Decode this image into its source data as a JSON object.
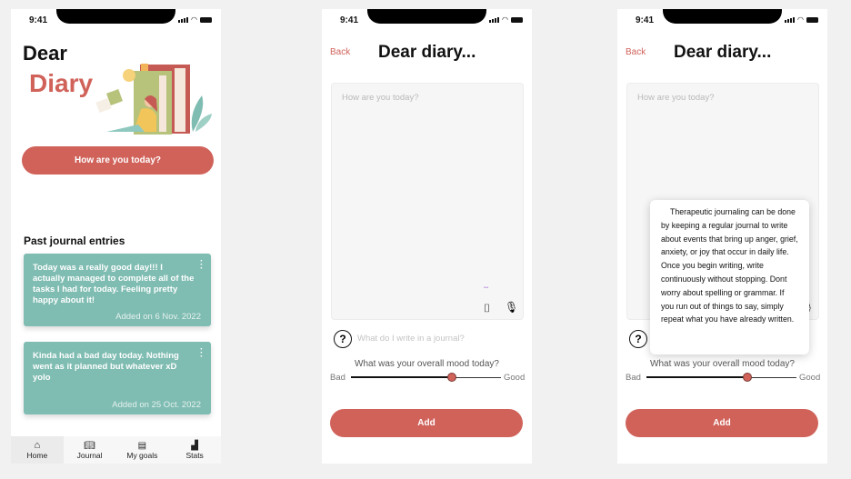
{
  "status": {
    "time": "9:41"
  },
  "home": {
    "title_line1": "Dear",
    "title_line2": "Diary",
    "cta": "How are you today?",
    "section_title": "Past journal entries",
    "entries": [
      {
        "text": "Today was a really good day!!! I actually managed to complete all of the tasks I had for today. Feeling pretty happy about it!",
        "date": "Added on 6 Nov. 2022"
      },
      {
        "text": "Kinda had a bad day today. Nothing went as it planned but whatever xD yolo",
        "date": "Added on 25 Oct. 2022"
      }
    ],
    "nav": [
      {
        "label": "Home",
        "icon": "home-icon"
      },
      {
        "label": "Journal",
        "icon": "book-icon"
      },
      {
        "label": "My goals",
        "icon": "goals-icon"
      },
      {
        "label": "Stats",
        "icon": "stats-icon"
      }
    ]
  },
  "entry": {
    "back": "Back",
    "title": "Dear diary...",
    "placeholder": "How are you today?",
    "dots": "•••",
    "help": "?",
    "help_text": "What do I write in a journal?",
    "mood_question": "What was your overall mood today?",
    "bad": "Bad",
    "good": "Good",
    "mood_value": 0.67,
    "add": "Add",
    "tip": "Therapeutic journaling can be done by keeping a regular journal to write about events that bring up anger, grief, anxiety, or joy that occur in daily life. Once you begin writing, write continuously without stopping. Dont worry about spelling or grammar. If you run out of things to say, simply repeat what you have already written."
  },
  "colors": {
    "accent": "#d0625a",
    "card": "#7fbcb2"
  }
}
